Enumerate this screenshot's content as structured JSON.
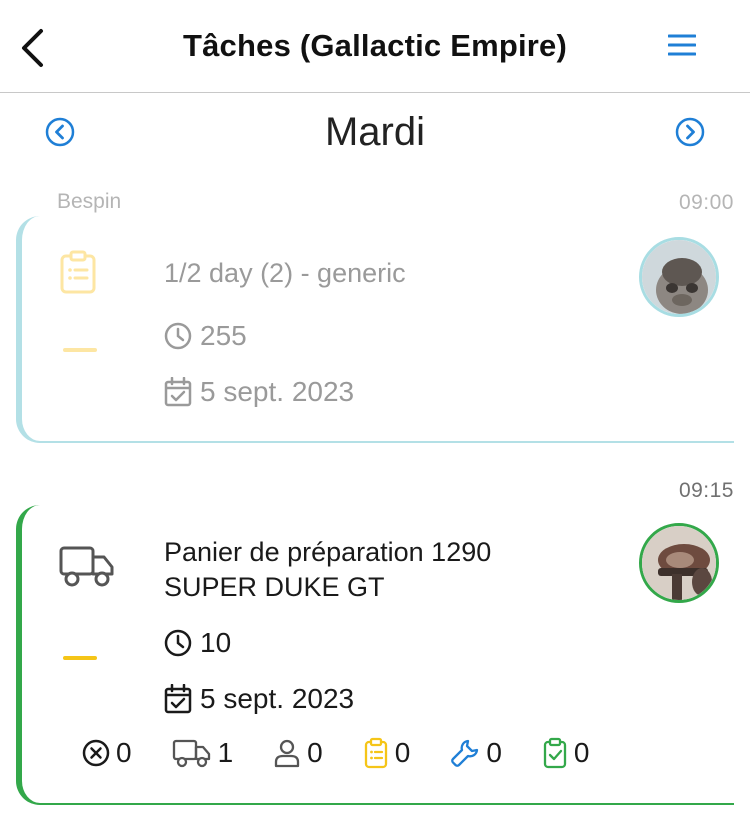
{
  "header": {
    "title": "Tâches (Gallactic Empire)",
    "back_icon": "chevron-left-icon",
    "menu_icon": "hamburger-menu-icon"
  },
  "day_nav": {
    "day": "Mardi",
    "prev_icon": "chevron-left-circle-icon",
    "next_icon": "chevron-right-circle-icon"
  },
  "group": {
    "label": "Bespin"
  },
  "tasks": [
    {
      "time": "09:00",
      "icon": "clipboard-icon",
      "title_line1": "1/2 day (2) - generic",
      "title_line2": "",
      "duration": "255",
      "date": "5 sept. 2023",
      "accent": "#b3e0e6",
      "dash_color": "#fde6a3"
    },
    {
      "time": "09:15",
      "icon": "truck-icon",
      "title_line1": "Panier de préparation 1290",
      "title_line2": "SUPER DUKE GT",
      "duration": "10",
      "date": "5 sept. 2023",
      "accent": "#33a84a",
      "dash_color": "#f5c518",
      "counters": [
        {
          "icon": "x-circle-icon",
          "value": "0",
          "color": "#1a1a1a"
        },
        {
          "icon": "truck-icon",
          "value": "1",
          "color": "#555555"
        },
        {
          "icon": "user-icon",
          "value": "0",
          "color": "#555555"
        },
        {
          "icon": "clipboard-icon",
          "value": "0",
          "color": "#f5c518"
        },
        {
          "icon": "wrench-icon",
          "value": "0",
          "color": "#1f7fd6"
        },
        {
          "icon": "clipboard-check-icon",
          "value": "0",
          "color": "#33a84a"
        }
      ]
    }
  ],
  "colors": {
    "link_blue": "#1f7fd6"
  }
}
